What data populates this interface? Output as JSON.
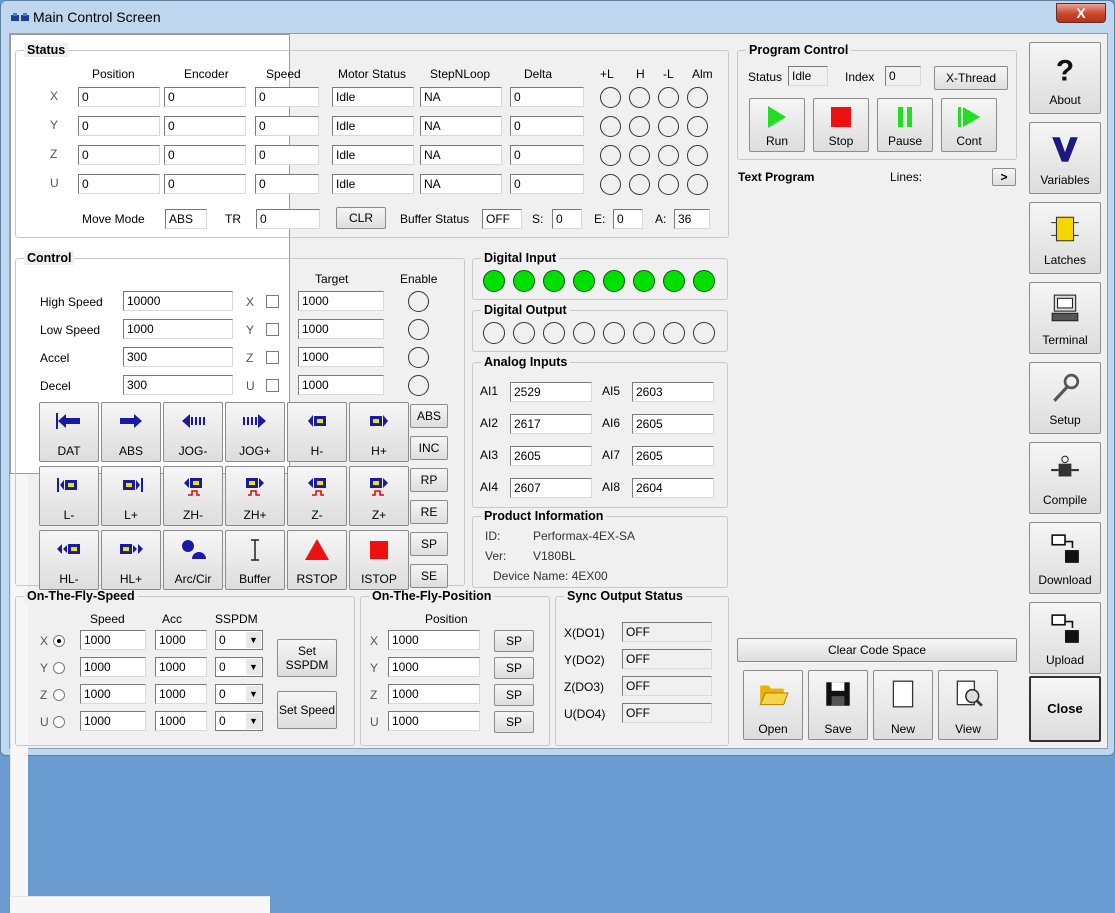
{
  "window": {
    "title": "Main Control Screen",
    "close_glyph": "X"
  },
  "status": {
    "legend": "Status",
    "headers": [
      "Position",
      "Encoder",
      "Speed",
      "Motor Status",
      "StepNLoop",
      "Delta",
      "+L",
      "H",
      "-L",
      "Alm"
    ],
    "rows": [
      {
        "axis": "X",
        "position": "0",
        "encoder": "0",
        "speed": "0",
        "motor_status": "Idle",
        "stepnloop": "NA",
        "delta": "0"
      },
      {
        "axis": "Y",
        "position": "0",
        "encoder": "0",
        "speed": "0",
        "motor_status": "Idle",
        "stepnloop": "NA",
        "delta": "0"
      },
      {
        "axis": "Z",
        "position": "0",
        "encoder": "0",
        "speed": "0",
        "motor_status": "Idle",
        "stepnloop": "NA",
        "delta": "0"
      },
      {
        "axis": "U",
        "position": "0",
        "encoder": "0",
        "speed": "0",
        "motor_status": "Idle",
        "stepnloop": "NA",
        "delta": "0"
      }
    ],
    "move_mode_label": "Move Mode",
    "move_mode": "ABS",
    "tr_label": "TR",
    "tr": "0",
    "clr": "CLR",
    "buffer_status_label": "Buffer Status",
    "buffer_status": "OFF",
    "s_label": "S:",
    "s": "0",
    "e_label": "E:",
    "e": "0",
    "a_label": "A:",
    "a": "36"
  },
  "control": {
    "legend": "Control",
    "target_label": "Target",
    "enable_label": "Enable",
    "high_speed_label": "High Speed",
    "high_speed": "10000",
    "low_speed_label": "Low Speed",
    "low_speed": "1000",
    "accel_label": "Accel",
    "accel": "300",
    "decel_label": "Decel",
    "decel": "300",
    "axes": [
      {
        "axis": "X",
        "target": "1000"
      },
      {
        "axis": "Y",
        "target": "1000"
      },
      {
        "axis": "Z",
        "target": "1000"
      },
      {
        "axis": "U",
        "target": "1000"
      }
    ],
    "motion_buttons": [
      "DAT",
      "ABS",
      "JOG-",
      "JOG+",
      "H-",
      "H+",
      "L-",
      "L+",
      "ZH-",
      "ZH+",
      "Z-",
      "Z+",
      "HL-",
      "HL+",
      "Arc/Cir",
      "Buffer",
      "RSTOP",
      "ISTOP"
    ],
    "side_buttons": [
      "ABS",
      "INC",
      "RP",
      "RE",
      "SP",
      "SE"
    ]
  },
  "digital_input": {
    "legend": "Digital Input",
    "states": [
      true,
      true,
      true,
      true,
      true,
      true,
      true,
      true
    ]
  },
  "digital_output": {
    "legend": "Digital Output",
    "states": [
      false,
      false,
      false,
      false,
      false,
      false,
      false,
      false
    ]
  },
  "analog": {
    "legend": "Analog Inputs",
    "items": [
      {
        "label": "AI1",
        "value": "2529"
      },
      {
        "label": "AI2",
        "value": "2617"
      },
      {
        "label": "AI3",
        "value": "2605"
      },
      {
        "label": "AI4",
        "value": "2607"
      },
      {
        "label": "AI5",
        "value": "2603"
      },
      {
        "label": "AI6",
        "value": "2605"
      },
      {
        "label": "AI7",
        "value": "2605"
      },
      {
        "label": "AI8",
        "value": "2604"
      }
    ]
  },
  "product": {
    "legend": "Product Information",
    "id_label": "ID:",
    "id": "Performax-4EX-SA",
    "ver_label": "Ver:",
    "ver": "V180BL",
    "device_name": "Device Name: 4EX00"
  },
  "otf_speed": {
    "legend": "On-The-Fly-Speed",
    "headers": [
      "Speed",
      "Acc",
      "SSPDM"
    ],
    "rows": [
      {
        "axis": "X",
        "speed": "1000",
        "acc": "1000",
        "sspdm": "0",
        "selected": true
      },
      {
        "axis": "Y",
        "speed": "1000",
        "acc": "1000",
        "sspdm": "0",
        "selected": false
      },
      {
        "axis": "Z",
        "speed": "1000",
        "acc": "1000",
        "sspdm": "0",
        "selected": false
      },
      {
        "axis": "U",
        "speed": "1000",
        "acc": "1000",
        "sspdm": "0",
        "selected": false
      }
    ],
    "set_sspdm": "Set SSPDM",
    "set_speed": "Set Speed"
  },
  "otf_position": {
    "legend": "On-The-Fly-Position",
    "header": "Position",
    "rows": [
      {
        "axis": "X",
        "position": "1000",
        "button": "SP"
      },
      {
        "axis": "Y",
        "position": "1000",
        "button": "SP"
      },
      {
        "axis": "Z",
        "position": "1000",
        "button": "SP"
      },
      {
        "axis": "U",
        "position": "1000",
        "button": "SP"
      }
    ]
  },
  "sync": {
    "legend": "Sync Output Status",
    "rows": [
      {
        "label": "X(DO1)",
        "value": "OFF"
      },
      {
        "label": "Y(DO2)",
        "value": "OFF"
      },
      {
        "label": "Z(DO3)",
        "value": "OFF"
      },
      {
        "label": "U(DO4)",
        "value": "OFF"
      }
    ]
  },
  "program": {
    "legend": "Program Control",
    "status_label": "Status",
    "status": "Idle",
    "index_label": "Index",
    "index": "0",
    "xthread": "X-Thread",
    "buttons": [
      "Run",
      "Stop",
      "Pause",
      "Cont"
    ],
    "text_program_label": "Text Program",
    "lines_label": "Lines:",
    "lines_arrow": ">",
    "clear_code": "Clear Code Space",
    "file_buttons": [
      "Open",
      "Save",
      "New",
      "View"
    ]
  },
  "sidebar": {
    "buttons": [
      "About",
      "Variables",
      "Latches",
      "Terminal",
      "Setup",
      "Compile",
      "Download",
      "Upload",
      "Close"
    ]
  },
  "colors": {
    "green_led": "#00e000",
    "run_green": "#22dd22",
    "stop_red": "#ee1111",
    "arrow_blue": "#1a1aa0",
    "title_bg": "#bfd7ee"
  }
}
